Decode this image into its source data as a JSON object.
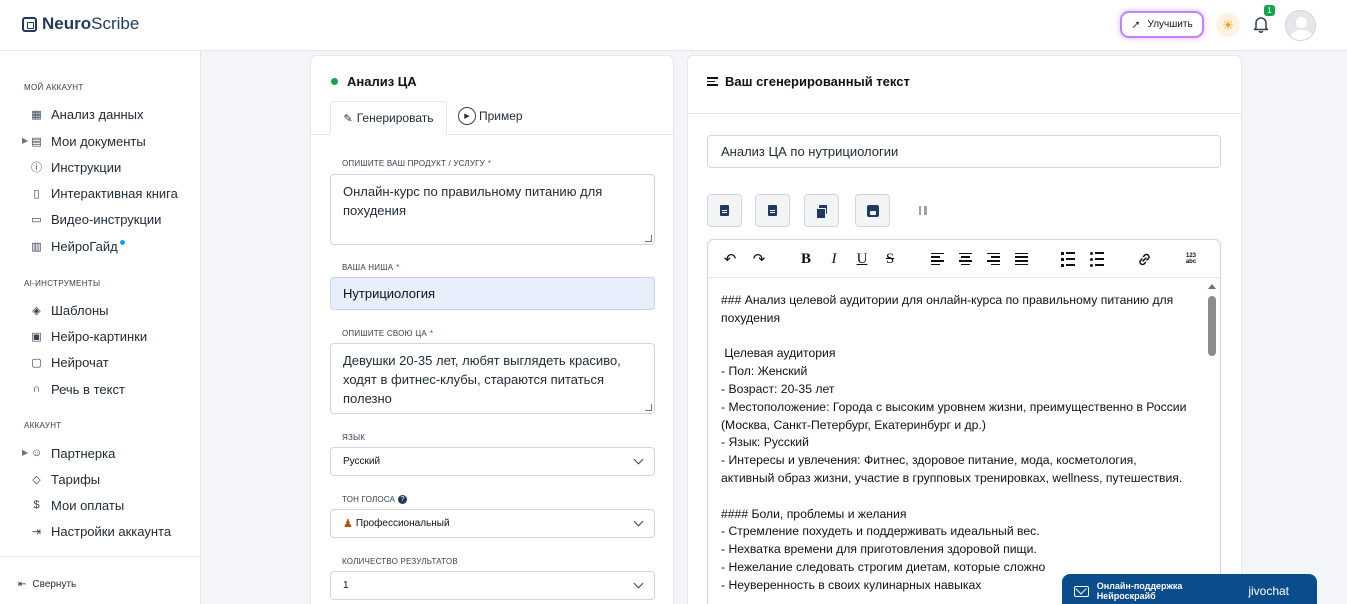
{
  "app": {
    "logo_bold": "Neuro",
    "logo_rest": "Scribe"
  },
  "header": {
    "upgrade_label": "Улучшить",
    "notifications_count": "1"
  },
  "sidebar": {
    "sections": [
      {
        "title": "Мой аккаунт"
      },
      {
        "title": "AI-инструменты"
      },
      {
        "title": "Аккаунт"
      }
    ],
    "items": [
      {
        "label": "Анализ данных",
        "icon": "grid-icon"
      },
      {
        "label": "Мои документы",
        "icon": "document-icon"
      },
      {
        "label": "Инструкции",
        "icon": "question-icon"
      },
      {
        "label": "Интерактивная книга",
        "icon": "book-icon"
      },
      {
        "label": "Видео-инструкции",
        "icon": "video-icon"
      },
      {
        "label": "НейроГайд",
        "icon": "guide-icon"
      },
      {
        "label": "Шаблоны",
        "icon": "layers-icon"
      },
      {
        "label": "Нейро-картинки",
        "icon": "image-icon"
      },
      {
        "label": "Нейрочат",
        "icon": "chat-icon"
      },
      {
        "label": "Речь в текст",
        "icon": "headphones-icon"
      },
      {
        "label": "Партнерка",
        "icon": "users-icon"
      },
      {
        "label": "Тарифы",
        "icon": "tag-icon"
      },
      {
        "label": "Мои оплаты",
        "icon": "dollar-icon"
      },
      {
        "label": "Настройки аккаунта",
        "icon": "logout-icon"
      }
    ],
    "collapse_label": "Свернуть"
  },
  "form": {
    "title": "Анализ ЦА",
    "tab_generate": "Генерировать",
    "tab_example": "Пример",
    "product_label": "Опишите ваш продукт / услугу",
    "product_value": "Онлайн-курс по правильному питанию для похудения",
    "niche_label": "Ваша ниша",
    "niche_value": "Нутрициология",
    "audience_label": "Опишите свою ЦА ",
    "audience_value": "Девушки 20-35 лет, любят выглядеть красиво, ходят в фитнес-клубы, стараются питаться полезно",
    "language_label": "Язык",
    "language_value": "Русский",
    "tone_label": "Тон голоса",
    "tone_value": "Профессиональный",
    "count_label": "Количество результатов",
    "count_value": "1",
    "required_mark": "*",
    "help_mark": "?"
  },
  "result": {
    "title": "Ваш сгенерированный текст",
    "doc_title": "Анализ ЦА по нутрициологии",
    "toolbar_labels": {
      "bold": "B",
      "italic": "I",
      "underline": "U",
      "strike": "S",
      "spell_top": "123",
      "spell_bottom": "abc"
    },
    "content": "### Анализ целевой аудитории для онлайн-курса по правильному питанию для похудения\n\n Целевая аудитория\n- Пол: Женский\n- Возраст: 20-35 лет\n- Местоположение: Города с высоким уровнем жизни, преимущественно в России (Москва, Санкт-Петербург, Екатеринбург и др.)\n- Язык: Русский\n- Интересы и увлечения: Фитнес, здоровое питание, мода, косметология, активный образ жизни, участие в групповых тренировках, wellness, путешествия.\n\n#### Боли, проблемы и желания\n- Стремление похудеть и поддерживать идеальный вес.\n- Нехватка времени для приготовления здоровой пищи.\n- Нежелание следовать строгим диетам, которые сложно\n- Неуверенность в своих кулинарных навыках"
  },
  "chat_widget": {
    "label": "Онлайн-поддержка Нейроскрайб",
    "brand": "jivochat"
  }
}
